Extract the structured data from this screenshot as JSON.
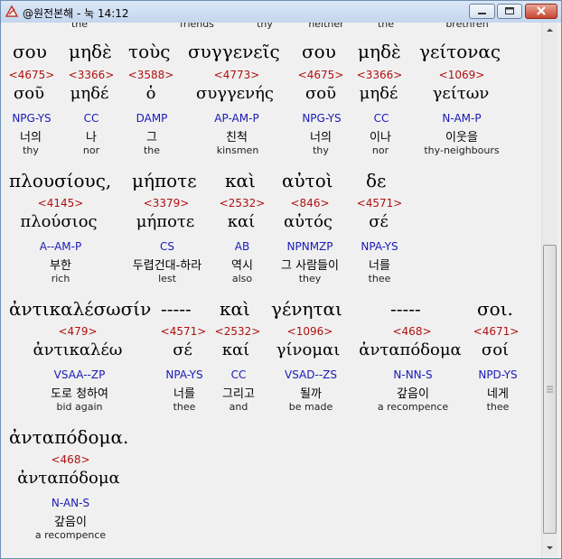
{
  "window": {
    "title": "@원전본해 - 눅 14:12",
    "buttons": {
      "minimize": "minimize",
      "maximize": "maximize",
      "close": "close"
    }
  },
  "top_partial": [
    "the",
    "friends",
    "thy",
    "neither",
    "the",
    "brethren"
  ],
  "blocks": [
    {
      "words": [
        {
          "greek": "σου",
          "strong": "<4675>",
          "lemma": "σοῦ",
          "morph": "NPG-YS",
          "korean": "너의",
          "english": "thy"
        },
        {
          "greek": "μηδὲ",
          "strong": "<3366>",
          "lemma": "μηδέ",
          "morph": "CC",
          "korean": "나",
          "english": "nor"
        },
        {
          "greek": "τοὺς",
          "strong": "<3588>",
          "lemma": "ὁ",
          "morph": "DAMP",
          "korean": "그",
          "english": "the"
        },
        {
          "greek": "συγγενεῖς",
          "strong": "<4773>",
          "lemma": "συγγενής",
          "morph": "AP-AM-P",
          "korean": "친척",
          "english": "kinsmen"
        },
        {
          "greek": "σου",
          "strong": "<4675>",
          "lemma": "σοῦ",
          "morph": "NPG-YS",
          "korean": "너의",
          "english": "thy"
        },
        {
          "greek": "μηδὲ",
          "strong": "<3366>",
          "lemma": "μηδέ",
          "morph": "CC",
          "korean": "이나",
          "english": "nor"
        },
        {
          "greek": "γείτονας",
          "strong": "<1069>",
          "lemma": "γείτων",
          "morph": "N-AM-P",
          "korean": "이웃을",
          "english": "thy-neighbours"
        }
      ]
    },
    {
      "words": [
        {
          "greek": "πλουσίους,",
          "strong": "<4145>",
          "lemma": "πλούσιος",
          "morph": "A--AM-P",
          "korean": "부한",
          "english": "rich"
        },
        {
          "greek": "μήποτε",
          "strong": "<3379>",
          "lemma": "μήποτε",
          "morph": "CS",
          "korean": "두렵건대-하라",
          "english": "lest"
        },
        {
          "greek": "καὶ",
          "strong": "<2532>",
          "lemma": "καί",
          "morph": "AB",
          "korean": "역시",
          "english": "also"
        },
        {
          "greek": "αὐτοὶ",
          "strong": "<846>",
          "lemma": "αὐτός",
          "morph": "NPNMZP",
          "korean": "그 사람들이",
          "english": "they"
        },
        {
          "greek": "δε",
          "strong": "<4571>",
          "lemma": "σέ",
          "morph": "NPA-YS",
          "korean": "너를",
          "english": "thee"
        }
      ]
    },
    {
      "words": [
        {
          "greek": "ἀντικαλέσωσίν",
          "strong": "<479>",
          "lemma": "ἀντικαλέω",
          "morph": "VSAA--ZP",
          "korean": "도로 청하여",
          "english": "bid again"
        },
        {
          "greek": "-----",
          "strong": "<4571>",
          "lemma": "σέ",
          "morph": "NPA-YS",
          "korean": "너를",
          "english": "thee"
        },
        {
          "greek": "καὶ",
          "strong": "<2532>",
          "lemma": "καί",
          "morph": "CC",
          "korean": "그리고",
          "english": "and"
        },
        {
          "greek": "γένηται",
          "strong": "<1096>",
          "lemma": "γίνομαι",
          "morph": "VSAD--ZS",
          "korean": "될까",
          "english": "be made"
        },
        {
          "greek": "-----",
          "strong": "<468>",
          "lemma": "ἀνταπόδομα",
          "morph": "N-NN-S",
          "korean": "갚음이",
          "english": "a recompence"
        },
        {
          "greek": "σοι.",
          "strong": "<4671>",
          "lemma": "σοί",
          "morph": "NPD-YS",
          "korean": "네게",
          "english": "thee"
        }
      ]
    },
    {
      "words": [
        {
          "greek": "ἀνταπόδομα.",
          "strong": "<468>",
          "lemma": "ἀνταπόδομα",
          "morph": "N-AN-S",
          "korean": "갚음이",
          "english": "a recompence"
        }
      ]
    }
  ],
  "colors": {
    "strong": "#b01010",
    "morph": "#1a1ab8",
    "background": "#f0f0f0"
  }
}
